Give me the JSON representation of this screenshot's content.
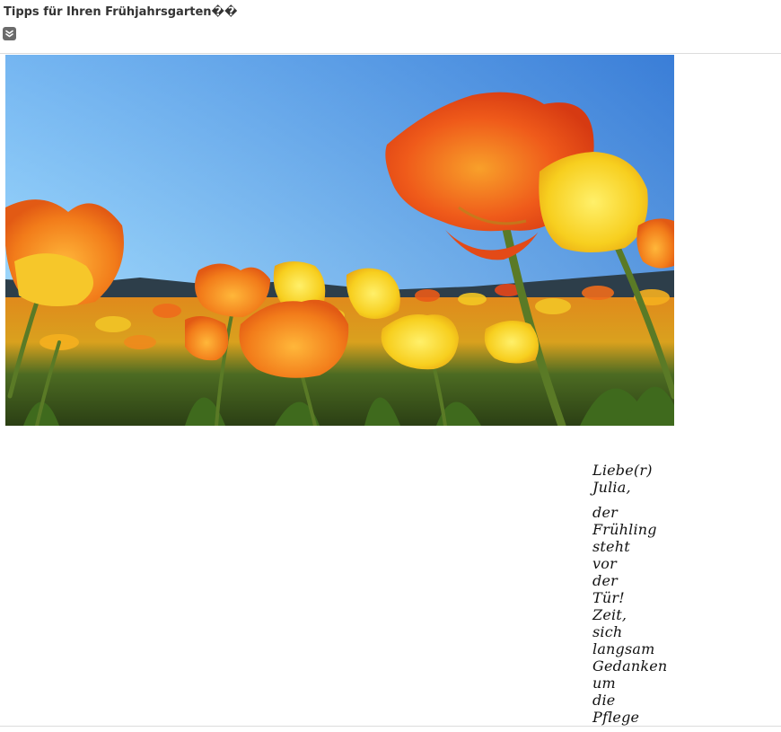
{
  "email": {
    "subject": "Tipps für Ihren Frühjahrsgarten��",
    "expand_icon": "double-chevron-down-icon"
  },
  "letter": {
    "greeting": "Liebe(r) Julia,",
    "body": "der Frühling steht vor der Tür! Zeit, sich langsam Gedanken um die Pflege"
  },
  "colors": {
    "sky_top": "#3d8be0",
    "sky_bottom": "#bfe6ff",
    "tulip_red": "#e8471a",
    "tulip_orange": "#f07a18",
    "tulip_yellow": "#f6cf1e",
    "stem_green": "#5a7a26"
  }
}
